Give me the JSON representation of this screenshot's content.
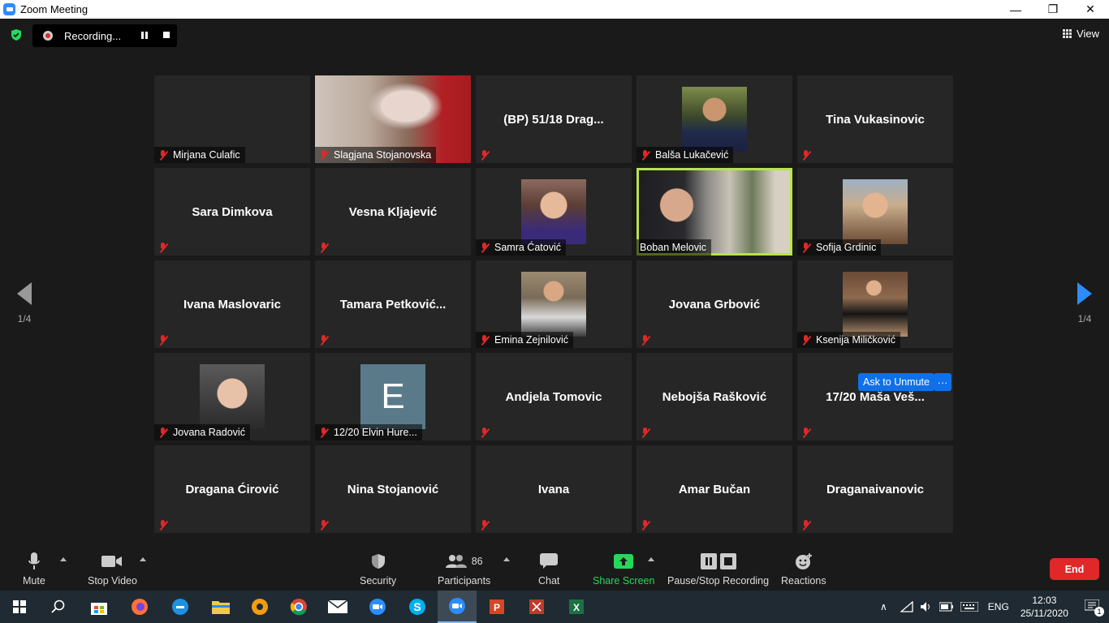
{
  "window": {
    "title": "Zoom Meeting",
    "minimize": "—",
    "maximize": "❐",
    "close": "✕"
  },
  "recording": {
    "label": "Recording..."
  },
  "view": {
    "label": "View"
  },
  "pagination": {
    "left": "1/4",
    "right": "1/4"
  },
  "tiles": [
    {
      "name": "Mirjana Culafic",
      "photo": false,
      "big": ""
    },
    {
      "name": "Slagjana Stojanovska",
      "photo": "blossom",
      "big": ""
    },
    {
      "name": "",
      "photo": false,
      "big": "(BP) 51/18 Drag..."
    },
    {
      "name": "Balša Lukačević",
      "photo": "man1",
      "big": ""
    },
    {
      "name": "",
      "photo": false,
      "big": "Tina Vukasinovic"
    },
    {
      "name": "",
      "photo": false,
      "big": "Sara Dimkova"
    },
    {
      "name": "",
      "photo": false,
      "big": "Vesna Kljajević"
    },
    {
      "name": "Samra Ćatović",
      "photo": "girl1",
      "big": ""
    },
    {
      "name": "Boban Melovic",
      "photo": "boban",
      "big": "",
      "active": true
    },
    {
      "name": "Sofija Grdinic",
      "photo": "girl2",
      "big": ""
    },
    {
      "name": "",
      "photo": false,
      "big": "Ivana Maslovaric"
    },
    {
      "name": "",
      "photo": false,
      "big": "Tamara  Petković..."
    },
    {
      "name": "Emina Zejnilović",
      "photo": "girl3",
      "big": ""
    },
    {
      "name": "",
      "photo": false,
      "big": "Jovana Grbović"
    },
    {
      "name": "Ksenija Miličković",
      "photo": "girl4",
      "big": ""
    },
    {
      "name": "Jovana Radović",
      "photo": "girl5",
      "big": ""
    },
    {
      "name": "12/20 Elvin Hure...",
      "photo": "e",
      "big": "",
      "initial": "E"
    },
    {
      "name": "",
      "photo": false,
      "big": "Andjela Tomovic"
    },
    {
      "name": "",
      "photo": false,
      "big": "Nebojša Rašković"
    },
    {
      "name": "",
      "photo": false,
      "big": "17/20 Maša Veš..."
    },
    {
      "name": "",
      "photo": false,
      "big": "Dragana Ćirović"
    },
    {
      "name": "",
      "photo": false,
      "big": "Nina Stojanović"
    },
    {
      "name": "",
      "photo": false,
      "big": "Ivana"
    },
    {
      "name": "",
      "photo": false,
      "big": "Amar Bučan"
    },
    {
      "name": "",
      "photo": false,
      "big": "Draganaivanovic"
    }
  ],
  "overlay": {
    "ask_unmute": "Ask to Unmute",
    "more": "···"
  },
  "toolbar": {
    "mute": "Mute",
    "stop_video": "Stop Video",
    "security": "Security",
    "participants": "Participants",
    "participants_count": "86",
    "chat": "Chat",
    "share_screen": "Share Screen",
    "recording": "Pause/Stop Recording",
    "reactions": "Reactions",
    "end": "End"
  },
  "taskbar": {
    "lang": "ENG",
    "time": "12:03",
    "date": "25/11/2020",
    "notifications": "1"
  },
  "colors": {
    "accent": "#2d8cff",
    "end": "#e02828",
    "share": "#23d959",
    "active_speaker": "#b7e34b"
  }
}
